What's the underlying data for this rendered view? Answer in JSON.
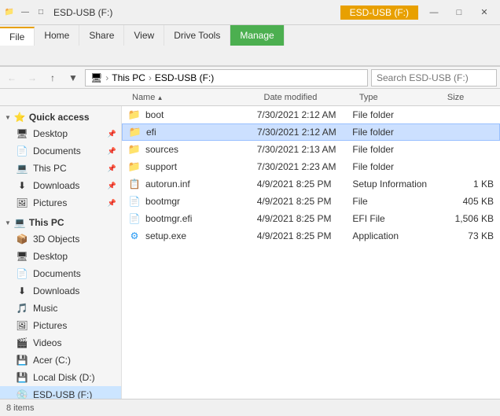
{
  "titleBar": {
    "usbLabel": "ESD-USB (F:)",
    "windowTitle": "ESD-USB (F:)"
  },
  "ribbon": {
    "tabs": [
      {
        "id": "file",
        "label": "File"
      },
      {
        "id": "home",
        "label": "Home"
      },
      {
        "id": "share",
        "label": "Share"
      },
      {
        "id": "view",
        "label": "View"
      },
      {
        "id": "drive-tools",
        "label": "Drive Tools"
      }
    ],
    "manageTab": "Manage"
  },
  "addressBar": {
    "breadcrumbs": [
      "This PC",
      "ESD-USB (F:)"
    ],
    "searchPlaceholder": "Search ESD-USB (F:)"
  },
  "columns": {
    "name": "Name",
    "dateModified": "Date modified",
    "type": "Type",
    "size": "Size"
  },
  "sidebar": {
    "quickAccess": {
      "label": "Quick access",
      "items": [
        {
          "id": "desktop",
          "label": "Desktop",
          "pinned": true
        },
        {
          "id": "documents",
          "label": "Documents",
          "pinned": true
        },
        {
          "id": "this-pc",
          "label": "This PC",
          "pinned": true
        },
        {
          "id": "downloads",
          "label": "Downloads",
          "pinned": true
        },
        {
          "id": "pictures",
          "label": "Pictures",
          "pinned": true
        }
      ]
    },
    "thisPC": {
      "label": "This PC",
      "items": [
        {
          "id": "3d-objects",
          "label": "3D Objects"
        },
        {
          "id": "desktop2",
          "label": "Desktop"
        },
        {
          "id": "documents2",
          "label": "Documents"
        },
        {
          "id": "downloads2",
          "label": "Downloads"
        },
        {
          "id": "music",
          "label": "Music"
        },
        {
          "id": "pictures2",
          "label": "Pictures"
        },
        {
          "id": "videos",
          "label": "Videos"
        },
        {
          "id": "acer",
          "label": "Acer (C:)"
        },
        {
          "id": "local-disk",
          "label": "Local Disk (D:)"
        },
        {
          "id": "esd-usb",
          "label": "ESD-USB (F:)",
          "active": true
        }
      ]
    }
  },
  "files": [
    {
      "id": "boot",
      "name": "boot",
      "type": "folder",
      "dateModified": "7/30/2021 2:12 AM",
      "fileType": "File folder",
      "size": ""
    },
    {
      "id": "efi",
      "name": "efi",
      "type": "folder",
      "dateModified": "7/30/2021 2:12 AM",
      "fileType": "File folder",
      "size": "",
      "selected": true
    },
    {
      "id": "sources",
      "name": "sources",
      "type": "folder",
      "dateModified": "7/30/2021 2:13 AM",
      "fileType": "File folder",
      "size": ""
    },
    {
      "id": "support",
      "name": "support",
      "type": "folder",
      "dateModified": "7/30/2021 2:23 AM",
      "fileType": "File folder",
      "size": ""
    },
    {
      "id": "autorun",
      "name": "autorun.inf",
      "type": "file",
      "dateModified": "4/9/2021 8:25 PM",
      "fileType": "Setup Information",
      "size": "1 KB"
    },
    {
      "id": "bootmgr",
      "name": "bootmgr",
      "type": "file",
      "dateModified": "4/9/2021 8:25 PM",
      "fileType": "File",
      "size": "405 KB"
    },
    {
      "id": "bootmgr-efi",
      "name": "bootmgr.efi",
      "type": "file",
      "dateModified": "4/9/2021 8:25 PM",
      "fileType": "EFI File",
      "size": "1,506 KB"
    },
    {
      "id": "setup",
      "name": "setup.exe",
      "type": "exe",
      "dateModified": "4/9/2021 8:25 PM",
      "fileType": "Application",
      "size": "73 KB"
    }
  ],
  "statusBar": {
    "text": "8 items"
  }
}
